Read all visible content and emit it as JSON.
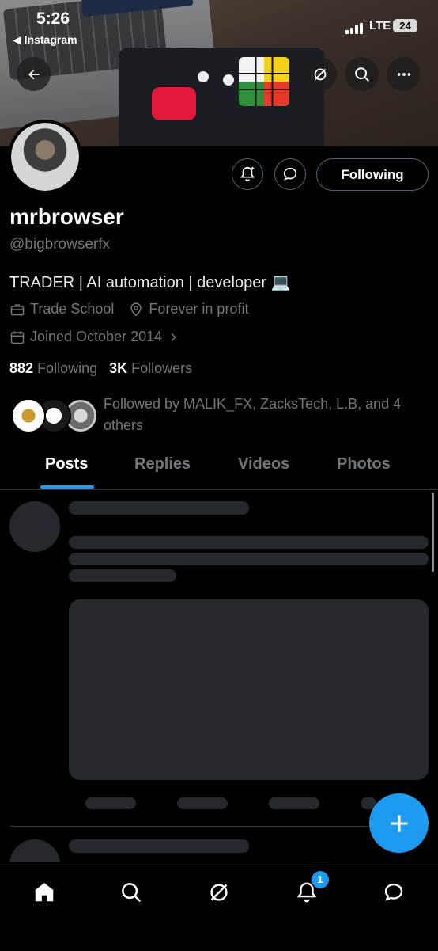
{
  "status_bar": {
    "time": "5:26",
    "back_app": "◀ Instagram",
    "network": "LTE",
    "battery": "24"
  },
  "header_icons": [
    "back-arrow-icon",
    "grok-icon",
    "search-icon",
    "more-icon"
  ],
  "profile": {
    "display_name": "mrbrowser",
    "handle": "@bigbrowserfx",
    "bio": "TRADER | AI automation | developer 💻",
    "category": "Trade School",
    "location": "Forever in profit",
    "joined": "Joined October 2014",
    "following_count": "882",
    "following_label": "Following",
    "followers_count": "3K",
    "followers_label": "Followers",
    "followed_by": "Followed by MALIK_FX, ZacksTech, L.B, and 4 others",
    "follow_button": "Following"
  },
  "tabs": [
    {
      "label": "Posts",
      "active": true
    },
    {
      "label": "Replies",
      "active": false
    },
    {
      "label": "Videos",
      "active": false
    },
    {
      "label": "Photos",
      "active": false
    }
  ],
  "notifications_badge": "1",
  "colors": {
    "accent": "#1d9bf0",
    "background": "#000000",
    "muted_text": "#71767b",
    "skeleton": "#25282c"
  }
}
